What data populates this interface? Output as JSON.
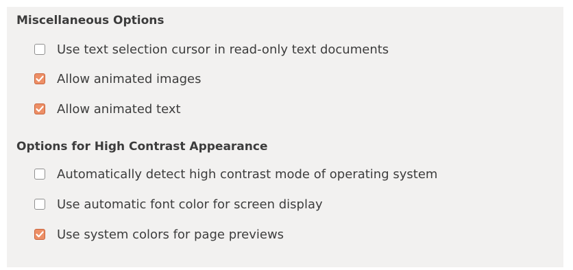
{
  "sections": [
    {
      "title": "Miscellaneous Options",
      "options": [
        {
          "label": "Use text selection cursor in read-only text documents",
          "checked": false
        },
        {
          "label": "Allow animated images",
          "checked": true
        },
        {
          "label": "Allow animated text",
          "checked": true
        }
      ]
    },
    {
      "title": "Options for High Contrast Appearance",
      "options": [
        {
          "label": "Automatically detect high contrast mode of operating system",
          "checked": false
        },
        {
          "label": "Use automatic font color for screen display",
          "checked": false
        },
        {
          "label": "Use system colors for page previews",
          "checked": true
        }
      ]
    }
  ],
  "colors": {
    "panel_background": "#f2f1f0",
    "checkbox_checked_fill": "#ed8f66",
    "checkbox_checked_border": "#c9633c",
    "text": "#3c3c3c"
  }
}
